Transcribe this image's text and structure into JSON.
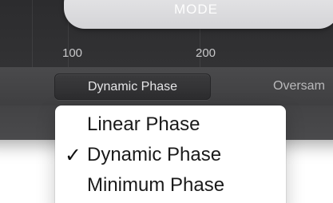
{
  "graph": {
    "mode_label": "MODE",
    "tick_labels": [
      "100",
      "200"
    ]
  },
  "toolbar": {
    "phase_button_label": "Dynamic Phase",
    "oversampling_label": "Oversam"
  },
  "phase_menu": {
    "items": [
      {
        "label": "Linear Phase",
        "checked": false
      },
      {
        "label": "Dynamic Phase",
        "checked": true
      },
      {
        "label": "Minimum Phase",
        "checked": false
      }
    ],
    "check_glyph": "✓"
  }
}
